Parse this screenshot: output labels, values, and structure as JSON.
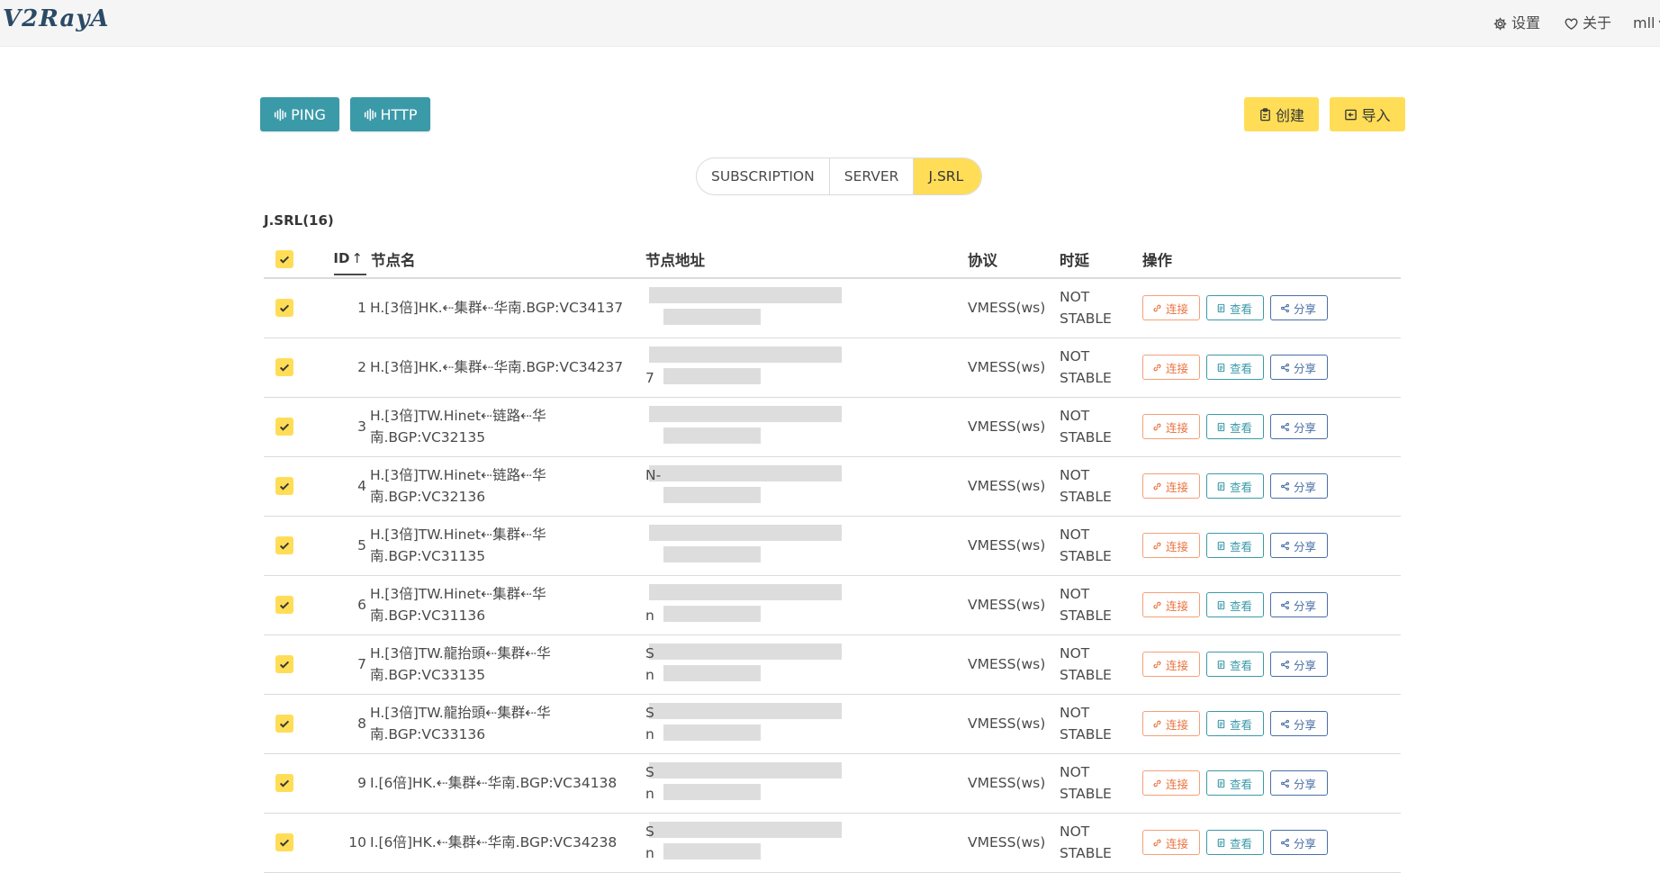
{
  "app": {
    "logo": "V2RayA"
  },
  "nav": {
    "settings": "设置",
    "about": "关于",
    "user": "mll"
  },
  "toolbar": {
    "ping": "PING",
    "http": "HTTP",
    "create": "创建",
    "import": "导入"
  },
  "tabs": [
    {
      "label": "SUBSCRIPTION",
      "active": false
    },
    {
      "label": "SERVER",
      "active": false
    },
    {
      "label": "J.SRL",
      "active": true
    }
  ],
  "group_title": "J.SRL(16)",
  "table": {
    "headers": {
      "id": "ID",
      "name": "节点名",
      "address": "节点地址",
      "protocol": "协议",
      "latency": "时延",
      "actions": "操作"
    },
    "actions": {
      "connect": "连接",
      "view": "查看",
      "share": "分享"
    },
    "rows": [
      {
        "id": "1",
        "name_line1": "H.[3倍]HK.⇠集群⇠华南.BGP:VC34137",
        "name_line2": "",
        "addr_line1": "",
        "addr_line2": "",
        "protocol": "VMESS(ws)",
        "latency_line1": "NOT",
        "latency_line2": "STABLE"
      },
      {
        "id": "2",
        "name_line1": "H.[3倍]HK.⇠集群⇠华南.BGP:VC34237",
        "name_line2": "",
        "addr_line1": "",
        "addr_line2": "7",
        "protocol": "VMESS(ws)",
        "latency_line1": "NOT",
        "latency_line2": "STABLE"
      },
      {
        "id": "3",
        "name_line1": "H.[3倍]TW.Hinet⇠链路⇠华",
        "name_line2": "南.BGP:VC32135",
        "addr_line1": "",
        "addr_line2": "",
        "protocol": "VMESS(ws)",
        "latency_line1": "NOT",
        "latency_line2": "STABLE"
      },
      {
        "id": "4",
        "name_line1": "H.[3倍]TW.Hinet⇠链路⇠华",
        "name_line2": "南.BGP:VC32136",
        "addr_line1": "N-",
        "addr_line2": "",
        "protocol": "VMESS(ws)",
        "latency_line1": "NOT",
        "latency_line2": "STABLE"
      },
      {
        "id": "5",
        "name_line1": "H.[3倍]TW.Hinet⇠集群⇠华",
        "name_line2": "南.BGP:VC31135",
        "addr_line1": "",
        "addr_line2": "",
        "protocol": "VMESS(ws)",
        "latency_line1": "NOT",
        "latency_line2": "STABLE"
      },
      {
        "id": "6",
        "name_line1": "H.[3倍]TW.Hinet⇠集群⇠华",
        "name_line2": "南.BGP:VC31136",
        "addr_line1": "",
        "addr_line2": "n",
        "protocol": "VMESS(ws)",
        "latency_line1": "NOT",
        "latency_line2": "STABLE"
      },
      {
        "id": "7",
        "name_line1": "H.[3倍]TW.龍抬頭⇠集群⇠华",
        "name_line2": "南.BGP:VC33135",
        "addr_line1": "S",
        "addr_line2": "n",
        "protocol": "VMESS(ws)",
        "latency_line1": "NOT",
        "latency_line2": "STABLE"
      },
      {
        "id": "8",
        "name_line1": "H.[3倍]TW.龍抬頭⇠集群⇠华",
        "name_line2": "南.BGP:VC33136",
        "addr_line1": "S",
        "addr_line2": "n",
        "protocol": "VMESS(ws)",
        "latency_line1": "NOT",
        "latency_line2": "STABLE"
      },
      {
        "id": "9",
        "name_line1": "I.[6倍]HK.⇠集群⇠华南.BGP:VC34138",
        "name_line2": "",
        "addr_line1": "S",
        "addr_line2": "n",
        "protocol": "VMESS(ws)",
        "latency_line1": "NOT",
        "latency_line2": "STABLE"
      },
      {
        "id": "10",
        "name_line1": "I.[6倍]HK.⇠集群⇠华南.BGP:VC34238",
        "name_line2": "",
        "addr_line1": "S",
        "addr_line2": "n",
        "protocol": "VMESS(ws)",
        "latency_line1": "NOT",
        "latency_line2": "STABLE"
      }
    ]
  },
  "colors": {
    "teal": "#3b9aa8",
    "yellow": "#ffdd57",
    "connect": "#e8733f",
    "share": "#4a6fa5"
  }
}
